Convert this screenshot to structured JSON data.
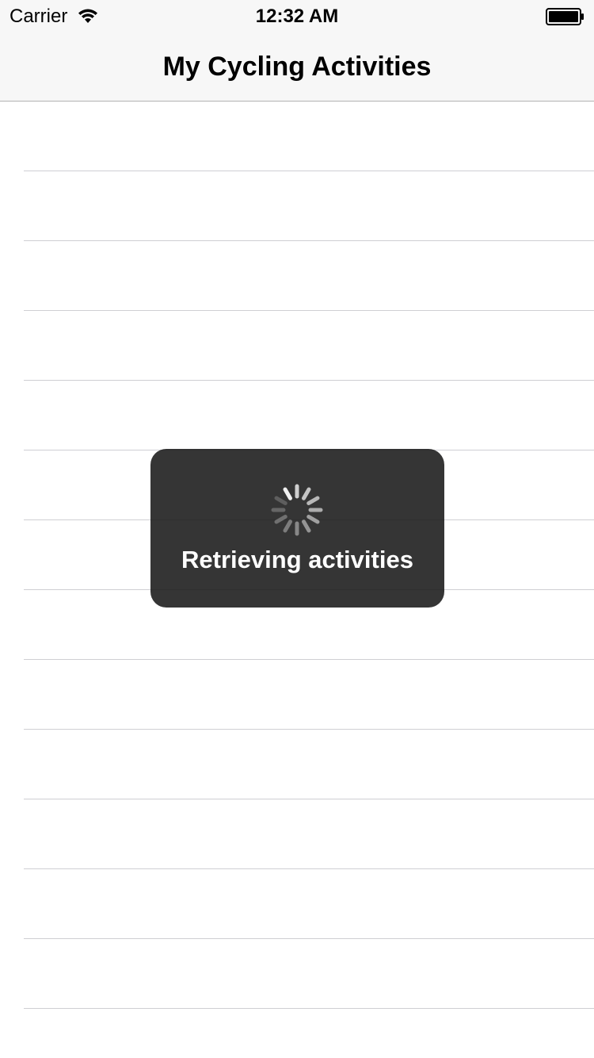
{
  "status_bar": {
    "carrier": "Carrier",
    "time": "12:32 AM",
    "icons": [
      "wifi-icon",
      "battery-icon"
    ]
  },
  "nav_bar": {
    "title": "My Cycling Activities"
  },
  "table": {
    "rows": [
      "",
      "",
      "",
      "",
      "",
      "",
      "",
      "",
      "",
      "",
      "",
      "",
      "",
      ""
    ]
  },
  "hud": {
    "message": "Retrieving activities",
    "icon": "activity-spinner-icon"
  },
  "colors": {
    "nav_background": "#f7f7f7",
    "separator": "#cfcfd3",
    "hud_background": "#191919"
  }
}
